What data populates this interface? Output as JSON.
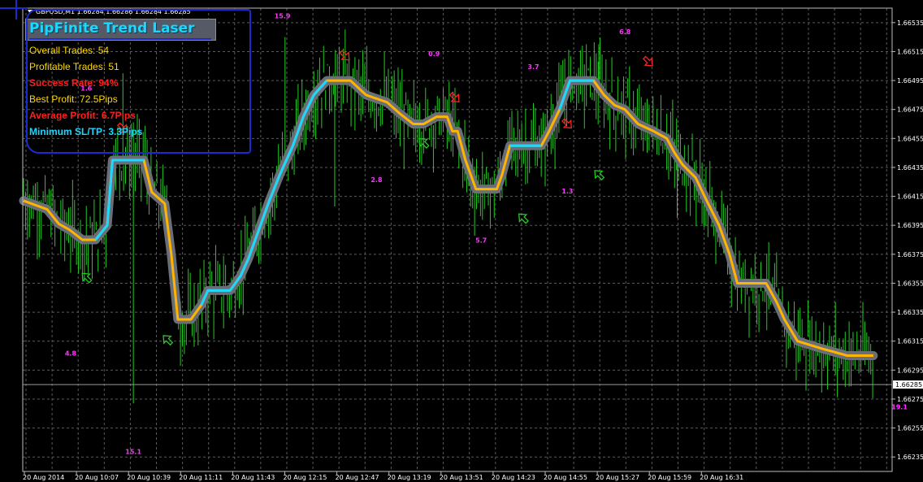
{
  "header": {
    "symbol_line": "GBPUSD,M1  1.66284 1.66286 1.66284 1.66285"
  },
  "indicator": {
    "title": "PipFinite Trend Laser",
    "overall_trades": "Overall Trades: 54",
    "profitable_trades": "Profitable Trades: 51",
    "success_rate": "Success Rate: 94%",
    "best_profit": "Best Profit: 72.5Pips",
    "average_profit": "Average Profit: 6.7Pips",
    "min_sl_tp": "Minimum SL/TP: 3.3Pips"
  },
  "colors": {
    "background": "#000000",
    "grid": "#5a5a5a",
    "candles": "#22cc22",
    "uptrend": "#1ad8ff",
    "downtrend": "#ffb400",
    "glow": "#6a6f77",
    "labels": "#ff33ff",
    "arrow_up": "#22cc22",
    "arrow_down": "#ff2222",
    "annotation": "#1a2bd0"
  },
  "chart_data": {
    "type": "line",
    "ylim": [
      1.66225,
      1.66545
    ],
    "yticks": [
      "1.66535",
      "1.66515",
      "1.66495",
      "1.66475",
      "1.66455",
      "1.66435",
      "1.66415",
      "1.66395",
      "1.66375",
      "1.66355",
      "1.66335",
      "1.66315",
      "1.66295",
      "1.66275",
      "1.66255",
      "1.66235"
    ],
    "current_price": "1.66285",
    "xticks": [
      "20 Aug 2014",
      "20 Aug 10:07",
      "20 Aug 10:39",
      "20 Aug 11:11",
      "20 Aug 11:43",
      "20 Aug 12:15",
      "20 Aug 12:47",
      "20 Aug 13:19",
      "20 Aug 13:51",
      "20 Aug 14:23",
      "20 Aug 14:55",
      "20 Aug 15:27",
      "20 Aug 15:59",
      "20 Aug 16:31"
    ],
    "bars": 425,
    "trend_line": [
      [
        0,
        1.66412
      ],
      [
        18,
        1.66406
      ],
      [
        27,
        1.66396
      ],
      [
        35,
        1.66392
      ],
      [
        45,
        1.66385
      ],
      [
        55,
        1.66385
      ],
      [
        64,
        1.66395
      ],
      [
        68,
        1.6644
      ],
      [
        92,
        1.6644
      ],
      [
        98,
        1.66418
      ],
      [
        108,
        1.6641
      ],
      [
        113,
        1.66375
      ],
      [
        118,
        1.6633
      ],
      [
        128,
        1.6633
      ],
      [
        136,
        1.6634
      ],
      [
        141,
        1.6635
      ],
      [
        158,
        1.6635
      ],
      [
        166,
        1.6636
      ],
      [
        172,
        1.66372
      ],
      [
        180,
        1.66392
      ],
      [
        188,
        1.66412
      ],
      [
        196,
        1.6643
      ],
      [
        206,
        1.6645
      ],
      [
        214,
        1.6647
      ],
      [
        222,
        1.66485
      ],
      [
        232,
        1.66495
      ],
      [
        250,
        1.66495
      ],
      [
        256,
        1.6649
      ],
      [
        262,
        1.66485
      ],
      [
        278,
        1.6648
      ],
      [
        288,
        1.66472
      ],
      [
        298,
        1.66465
      ],
      [
        306,
        1.66465
      ],
      [
        316,
        1.6647
      ],
      [
        324,
        1.6647
      ],
      [
        328,
        1.6646
      ],
      [
        332,
        1.6646
      ],
      [
        338,
        1.6644
      ],
      [
        346,
        1.6642
      ],
      [
        362,
        1.6642
      ],
      [
        366,
        1.6643
      ],
      [
        372,
        1.6645
      ],
      [
        396,
        1.6645
      ],
      [
        402,
        1.6646
      ],
      [
        410,
        1.66475
      ],
      [
        418,
        1.66495
      ],
      [
        436,
        1.66495
      ],
      [
        444,
        1.66485
      ],
      [
        452,
        1.66478
      ],
      [
        460,
        1.66475
      ],
      [
        470,
        1.66465
      ],
      [
        482,
        1.6646
      ],
      [
        492,
        1.66455
      ],
      [
        498,
        1.66445
      ],
      [
        504,
        1.66437
      ],
      [
        514,
        1.66428
      ],
      [
        522,
        1.66413
      ],
      [
        532,
        1.66395
      ],
      [
        540,
        1.66375
      ],
      [
        546,
        1.66355
      ],
      [
        568,
        1.66355
      ],
      [
        576,
        1.66342
      ],
      [
        582,
        1.6633
      ],
      [
        592,
        1.66315
      ],
      [
        610,
        1.6631
      ],
      [
        630,
        1.66305
      ],
      [
        650,
        1.66305
      ]
    ],
    "uptrend_segments": [
      [
        55,
        92
      ],
      [
        136,
        232
      ],
      [
        372,
        396
      ],
      [
        410,
        436
      ]
    ],
    "trade_labels": [
      {
        "text": "4.8",
        "x": 36,
        "y": 1.66305
      },
      {
        "text": "1.6",
        "x": 48,
        "y": 1.66488
      },
      {
        "text": "15.1",
        "x": 84,
        "y": 1.66237
      },
      {
        "text": "15.9",
        "x": 198,
        "y": 1.66538
      },
      {
        "text": "2.8",
        "x": 270,
        "y": 1.66425
      },
      {
        "text": "0.9",
        "x": 314,
        "y": 1.66512
      },
      {
        "text": "5.7",
        "x": 350,
        "y": 1.66383
      },
      {
        "text": "3.7",
        "x": 390,
        "y": 1.66503
      },
      {
        "text": "1.3",
        "x": 416,
        "y": 1.66417
      },
      {
        "text": "6.8",
        "x": 460,
        "y": 1.66527
      },
      {
        "text": "19.1",
        "x": 670,
        "y": 1.66268
      }
    ],
    "arrows": [
      {
        "dir": "up",
        "x": 48,
        "y": 1.66359
      },
      {
        "dir": "down",
        "x": 76,
        "y": 1.66462
      },
      {
        "dir": "up",
        "x": 110,
        "y": 1.66316
      },
      {
        "dir": "down",
        "x": 246,
        "y": 1.66512
      },
      {
        "dir": "up",
        "x": 306,
        "y": 1.66452
      },
      {
        "dir": "down",
        "x": 330,
        "y": 1.66483
      },
      {
        "dir": "up",
        "x": 382,
        "y": 1.664
      },
      {
        "dir": "down",
        "x": 416,
        "y": 1.66465
      },
      {
        "dir": "up",
        "x": 440,
        "y": 1.6643
      },
      {
        "dir": "down",
        "x": 478,
        "y": 1.66508
      }
    ]
  }
}
